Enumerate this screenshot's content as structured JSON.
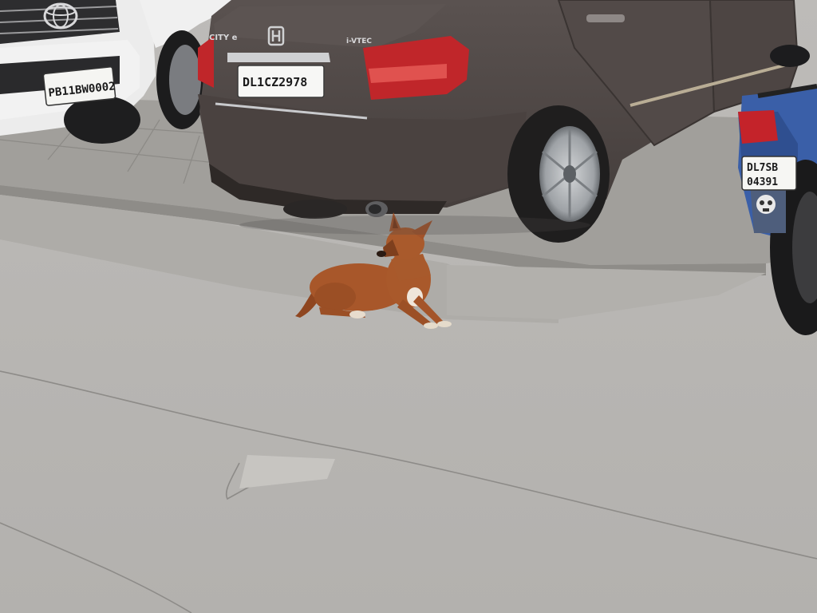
{
  "scene": {
    "colors": {
      "road": "#b9b7b4",
      "sidewalk": "#9e9c99",
      "car_body": "#4e4644",
      "white_suv": "#eaeaea",
      "taillight": "#c0262a",
      "dog_fur": "#a8572a",
      "scooter_blue": "#3a5fa8"
    },
    "white_suv": {
      "plate": "PB11BW0002",
      "icons": [
        "toyota-logo-icon"
      ]
    },
    "sedan": {
      "plate": "DL1CZ2978",
      "model_badge": "CITY e",
      "engine_badge": "i-VTEC",
      "icons": [
        "honda-logo-icon"
      ]
    },
    "scooter": {
      "plate_line1": "DL7SB",
      "plate_line2": "04391",
      "icons": [
        "skull-sticker-icon"
      ]
    },
    "dog": {
      "pose": "lying-down"
    }
  }
}
